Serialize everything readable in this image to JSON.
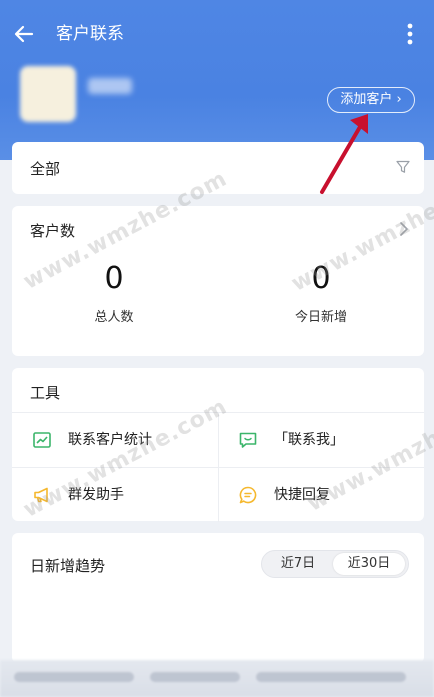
{
  "header": {
    "title": "客户联系",
    "add_customer_label": "添加客户 ›"
  },
  "filter": {
    "label": "全部"
  },
  "customer_count": {
    "title": "客户数",
    "total_value": "0",
    "total_label": "总人数",
    "today_value": "0",
    "today_label": "今日新增"
  },
  "tools": {
    "title": "工具",
    "items": [
      {
        "label": "联系客户统计",
        "icon": "chart-icon"
      },
      {
        "label": "「联系我」",
        "icon": "chat-icon"
      },
      {
        "label": "群发助手",
        "icon": "megaphone-icon"
      },
      {
        "label": "快捷回复",
        "icon": "quick-reply-icon"
      }
    ]
  },
  "trend": {
    "title": "日新增趋势",
    "options": [
      "近7日",
      "近30日"
    ],
    "selected": "近30日"
  },
  "watermark": "www.wmzhe.com",
  "colors": {
    "header_bg": "#4a82e2",
    "tool_icon_green": "#3bb56a",
    "tool_icon_yellow": "#f5b82e",
    "annotation_arrow": "#c8102e"
  }
}
